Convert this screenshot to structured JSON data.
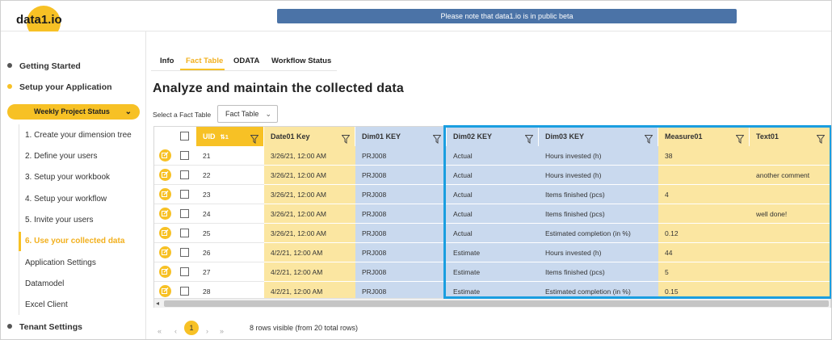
{
  "app": {
    "logo": "data1.io",
    "beta_notice": "Please note that data1.io is in public beta"
  },
  "sidebar": {
    "sections": [
      "Getting Started",
      "Setup your Application",
      "Tenant Settings"
    ],
    "project": "Weekly Project Status",
    "items": [
      "1. Create your dimension tree",
      "2. Define your users",
      "3. Setup your workbook",
      "4. Setup your workflow",
      "5. Invite your users",
      "6. Use your collected data",
      "Application Settings",
      "Datamodel",
      "Excel Client"
    ],
    "active_index": 5
  },
  "tabs": [
    "Info",
    "Fact Table",
    "ODATA",
    "Workflow Status"
  ],
  "active_tab": "Fact Table",
  "page_title": "Analyze and maintain the collected data",
  "fact_table_label": "Select a Fact Table",
  "fact_table_value": "Fact Table",
  "colors": {
    "accent": "#f7c125",
    "yellow_col": "#fbe6a1",
    "blue_col": "#c9d9ee",
    "highlight": "#1a9ee0",
    "beta_bar": "#4b73a7"
  },
  "grid": {
    "columns": [
      {
        "key": "uid",
        "label": "UID",
        "sort_icon": "⇅1"
      },
      {
        "key": "date01",
        "label": "Date01 Key"
      },
      {
        "key": "dim01",
        "label": "Dim01 KEY"
      },
      {
        "key": "dim02",
        "label": "Dim02 KEY"
      },
      {
        "key": "dim03",
        "label": "Dim03 KEY"
      },
      {
        "key": "measure01",
        "label": "Measure01"
      },
      {
        "key": "text01",
        "label": "Text01"
      }
    ],
    "rows": [
      {
        "uid": "21",
        "date01": "3/26/21, 12:00 AM",
        "dim01": "PRJ008",
        "dim02": "Actual",
        "dim03": "Hours invested (h)",
        "measure01": "38",
        "text01": ""
      },
      {
        "uid": "22",
        "date01": "3/26/21, 12:00 AM",
        "dim01": "PRJ008",
        "dim02": "Actual",
        "dim03": "Hours invested (h)",
        "measure01": "",
        "text01": "another comment"
      },
      {
        "uid": "23",
        "date01": "3/26/21, 12:00 AM",
        "dim01": "PRJ008",
        "dim02": "Actual",
        "dim03": "Items finished (pcs)",
        "measure01": "4",
        "text01": ""
      },
      {
        "uid": "24",
        "date01": "3/26/21, 12:00 AM",
        "dim01": "PRJ008",
        "dim02": "Actual",
        "dim03": "Items finished (pcs)",
        "measure01": "",
        "text01": "well done!"
      },
      {
        "uid": "25",
        "date01": "3/26/21, 12:00 AM",
        "dim01": "PRJ008",
        "dim02": "Actual",
        "dim03": "Estimated completion (in %)",
        "measure01": "0.12",
        "text01": ""
      },
      {
        "uid": "26",
        "date01": "4/2/21, 12:00 AM",
        "dim01": "PRJ008",
        "dim02": "Estimate",
        "dim03": "Hours invested (h)",
        "measure01": "44",
        "text01": ""
      },
      {
        "uid": "27",
        "date01": "4/2/21, 12:00 AM",
        "dim01": "PRJ008",
        "dim02": "Estimate",
        "dim03": "Items finished (pcs)",
        "measure01": "5",
        "text01": ""
      },
      {
        "uid": "28",
        "date01": "4/2/21, 12:00 AM",
        "dim01": "PRJ008",
        "dim02": "Estimate",
        "dim03": "Estimated completion (in %)",
        "measure01": "0.15",
        "text01": ""
      }
    ]
  },
  "pager": {
    "first": "«",
    "prev": "‹",
    "current": "1",
    "next": "›",
    "last": "»",
    "info": "8 rows visible (from 20 total rows)"
  }
}
